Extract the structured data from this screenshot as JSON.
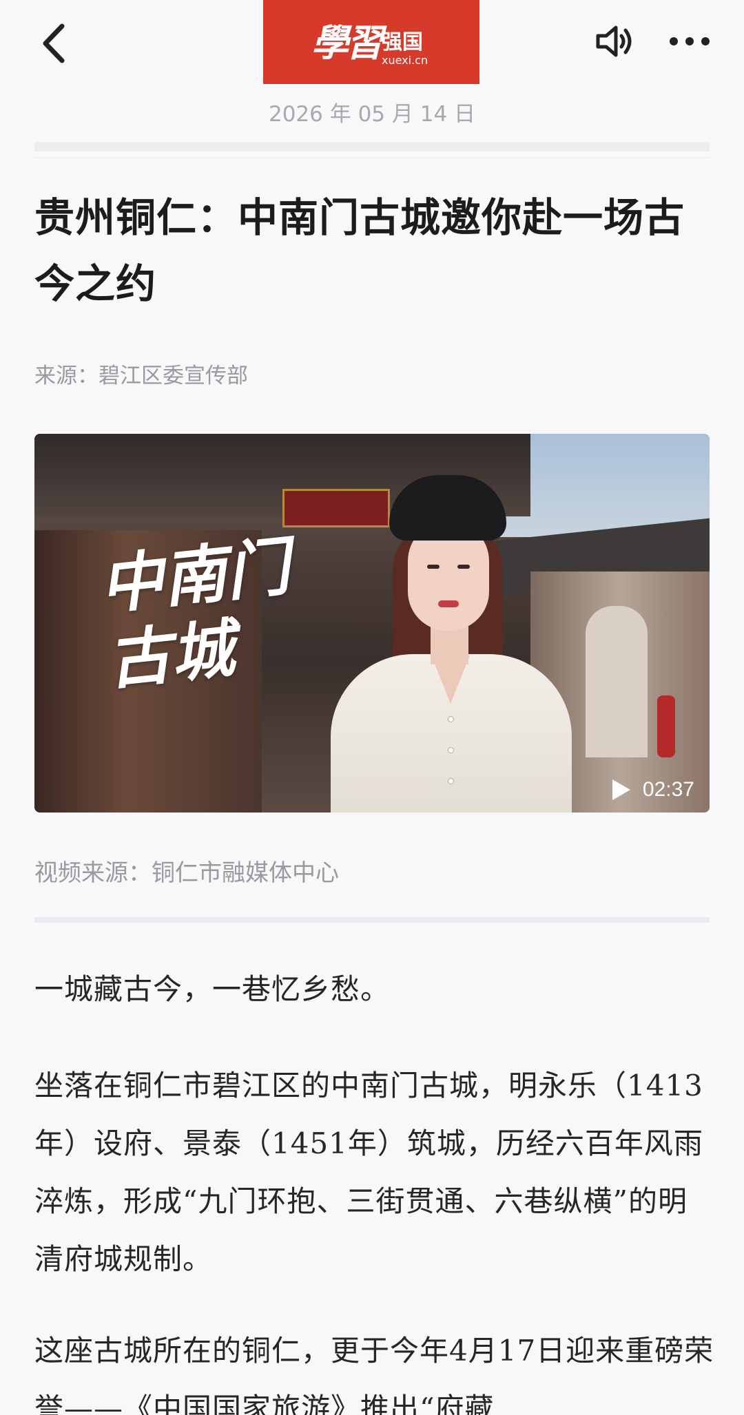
{
  "header": {
    "back_icon": "chevron-left-icon",
    "brand": {
      "calligraphy": "學習",
      "name": "强国",
      "url": "xuexi.cn"
    },
    "date": "2026 年 05 月 14 日",
    "sound_icon": "speaker-icon",
    "more_icon": "more-dots-icon"
  },
  "article": {
    "title": "贵州铜仁：中南门古城邀你赴一场古今之约",
    "source": "来源：碧江区委宣传部",
    "video": {
      "title_calligraphy": "中南门古城",
      "duration": "02:37",
      "source": "视频来源：铜仁市融媒体中心"
    },
    "paragraphs": [
      "一城藏古今，一巷忆乡愁。",
      "坐落在铜仁市碧江区的中南门古城，明永乐（1413年）设府、景泰（1451年）筑城，历经六百年风雨淬炼，形成“九门环抱、三街贯通、六巷纵横”的明清府城规制。",
      "这座古城所在的铜仁，更于今年4月17日迎来重磅荣誉——《中国国家旅游》推出“府藏"
    ]
  },
  "colors": {
    "brand_red": "#d63a2a",
    "meta_gray": "#9a9a9e"
  }
}
